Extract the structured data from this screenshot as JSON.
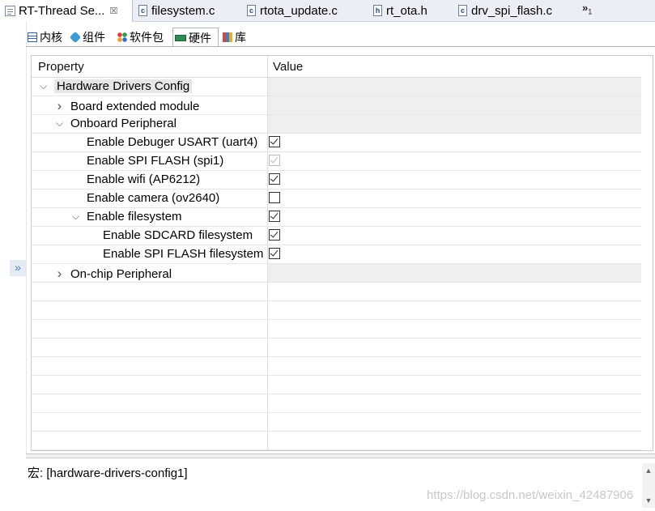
{
  "tabs": [
    {
      "label": "RT-Thread Se...",
      "icon": "rt-thread-settings-icon",
      "close": "☒",
      "active": true
    },
    {
      "label": "filesystem.c",
      "icon": "c-file-icon",
      "badge": "c"
    },
    {
      "label": "rtota_update.c",
      "icon": "c-file-icon",
      "badge": "c"
    },
    {
      "label": "rt_ota.h",
      "icon": "h-file-icon",
      "badge": "h"
    },
    {
      "label": "drv_spi_flash.c",
      "icon": "c-file-icon",
      "badge": "c"
    }
  ],
  "overflow": {
    "symbol": "»",
    "count": "1"
  },
  "subtabs": [
    {
      "label": "内核",
      "icon": "kernel-icon"
    },
    {
      "label": "组件",
      "icon": "components-icon"
    },
    {
      "label": "软件包",
      "icon": "packages-icon"
    },
    {
      "label": "硬件",
      "icon": "hardware-icon",
      "active": true
    },
    {
      "label": "库",
      "icon": "library-icon"
    }
  ],
  "expand_glyph": "»",
  "table": {
    "headers": {
      "property": "Property",
      "value": "Value"
    },
    "rows": [
      {
        "label": "Hardware Drivers Config",
        "level": 0,
        "toggle": "expanded",
        "selected": true,
        "value": "group"
      },
      {
        "label": "Board extended module",
        "level": 1,
        "toggle": "collapsed",
        "value": "group"
      },
      {
        "label": "Onboard Peripheral",
        "level": 1,
        "toggle": "expanded",
        "value": "group"
      },
      {
        "label": "Enable Debuger USART (uart4)",
        "level": 2,
        "value": "checked"
      },
      {
        "label": "Enable SPI FLASH (spi1)",
        "level": 2,
        "value": "checked-disabled"
      },
      {
        "label": "Enable wifi (AP6212)",
        "level": 2,
        "value": "checked"
      },
      {
        "label": "Enable camera (ov2640)",
        "level": 2,
        "value": "unchecked"
      },
      {
        "label": "Enable filesystem",
        "level": 2,
        "toggle": "expanded",
        "value": "checked"
      },
      {
        "label": "Enable SDCARD filesystem",
        "level": 3,
        "value": "checked"
      },
      {
        "label": "Enable SPI FLASH filesystem",
        "level": 3,
        "value": "checked"
      },
      {
        "label": "On-chip Peripheral",
        "level": 1,
        "toggle": "collapsed",
        "value": "group"
      }
    ],
    "empty_rows": 9
  },
  "description": "宏: [hardware-drivers-config1]",
  "watermark": "https://blog.csdn.net/weixin_42487906"
}
